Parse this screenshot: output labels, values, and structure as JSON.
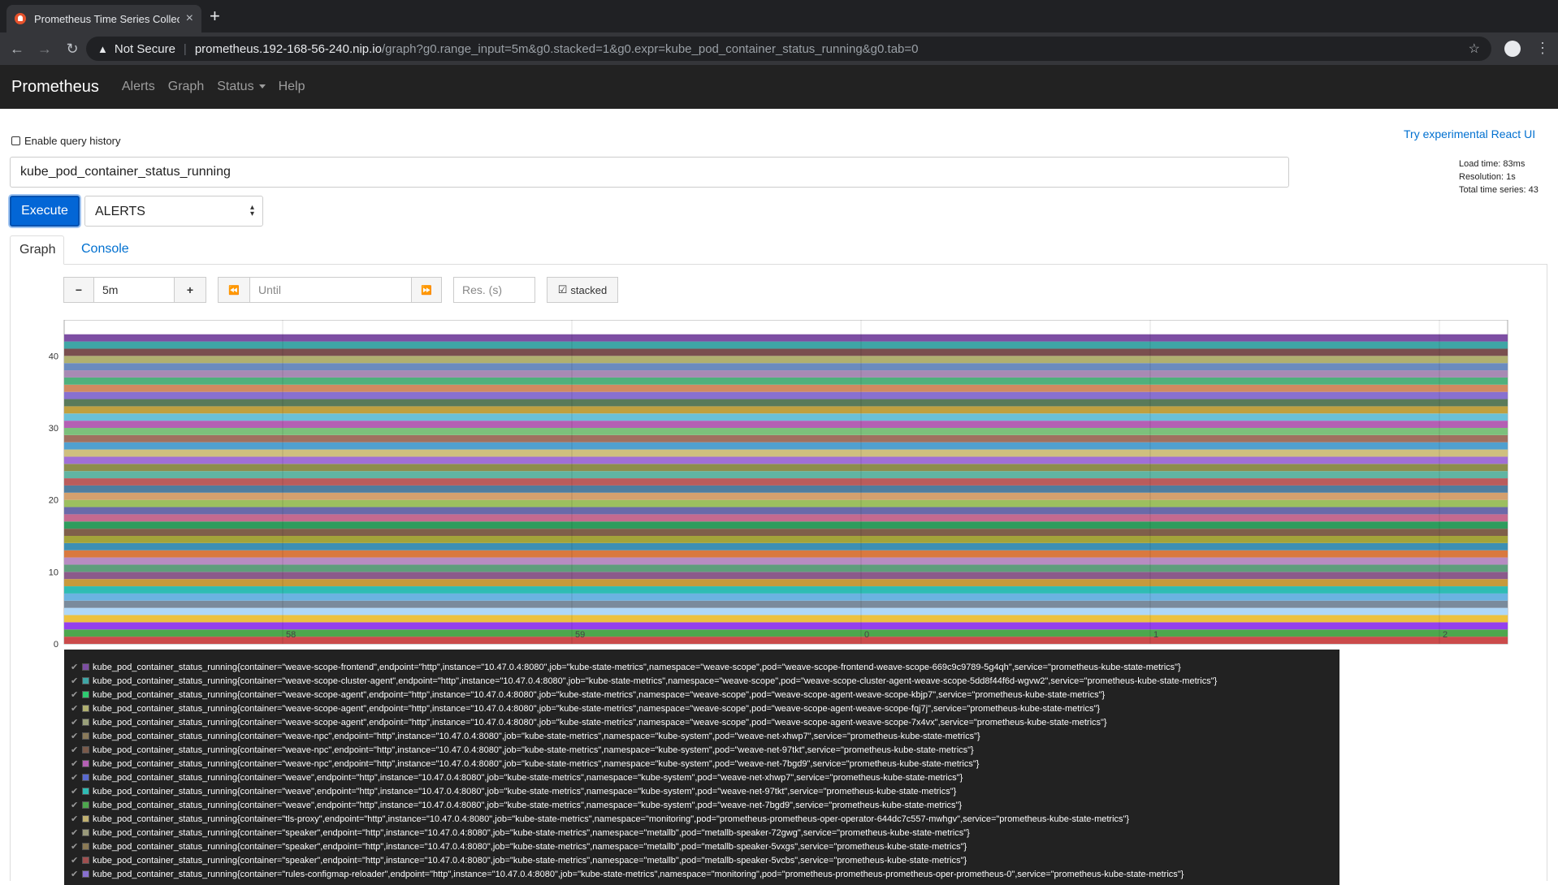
{
  "browser": {
    "tab_title": "Prometheus Time Series Collec",
    "new_tab": "+",
    "security": "Not Secure",
    "url_host": "prometheus.192-168-56-240.nip.io",
    "url_path": "/graph?g0.range_input=5m&g0.stacked=1&g0.expr=kube_pod_container_status_running&g0.tab=0"
  },
  "nav": {
    "brand": "Prometheus",
    "links": [
      "Alerts",
      "Graph",
      "Status",
      "Help"
    ]
  },
  "query": {
    "history_label": "Enable query history",
    "react_link": "Try experimental React UI",
    "stats": [
      "Load time: 83ms",
      "Resolution: 1s",
      "Total time series: 43"
    ],
    "expression": "kube_pod_container_status_running",
    "execute_label": "Execute",
    "insert_metric": "ALERTS"
  },
  "tabs": {
    "graph": "Graph",
    "console": "Console"
  },
  "controls": {
    "minus": "−",
    "range": "5m",
    "plus": "+",
    "back": "⏪",
    "until_placeholder": "Until",
    "forward": "⏩",
    "res_placeholder": "Res. (s)",
    "stacked": "stacked"
  },
  "chart_data": {
    "type": "area",
    "stacked": true,
    "ylim": [
      0,
      45
    ],
    "y_ticks": [
      "0",
      "10",
      "20",
      "30",
      "40"
    ],
    "x_ticks": [
      "58",
      "59",
      "0",
      "1",
      "2"
    ],
    "series_count": 43,
    "value_per_series": 1,
    "colors": [
      "#cb4b4b",
      "#4da74d",
      "#9440ed",
      "#edc240",
      "#afd8f8",
      "#7a8b9c",
      "#6bb3e1",
      "#2fbcb4",
      "#c79a3c",
      "#8b5a8b",
      "#5f9e7c",
      "#b88cc2",
      "#d9793f",
      "#3c8fb4",
      "#a3a33a",
      "#7f5f4a",
      "#2e9c5d",
      "#c56a8f",
      "#6a6aa9",
      "#9cbf5f",
      "#d4a06e",
      "#4f7d9f",
      "#ba5c5c",
      "#60b5a3",
      "#8d8d4c",
      "#a06fd6",
      "#cfbf7f",
      "#50a0d0",
      "#9f7060",
      "#7cc07c",
      "#b45fb4",
      "#6ac0d8",
      "#c0a040",
      "#5a7a5a",
      "#8870d0",
      "#d08a60",
      "#4fb07c",
      "#a88ab4",
      "#6a8bbf",
      "#b0b070",
      "#7a4f4f",
      "#3fa6a6",
      "#7d4ea3"
    ]
  },
  "legend": [
    {
      "text": "kube_pod_container_status_running{container=\"weave-scope-frontend\",endpoint=\"http\",instance=\"10.47.0.4:8080\",job=\"kube-state-metrics\",namespace=\"weave-scope\",pod=\"weave-scope-frontend-weave-scope-669c9c9789-5g4qh\",service=\"prometheus-kube-state-metrics\"}",
      "color": "#7d4ea3"
    },
    {
      "text": "kube_pod_container_status_running{container=\"weave-scope-cluster-agent\",endpoint=\"http\",instance=\"10.47.0.4:8080\",job=\"kube-state-metrics\",namespace=\"weave-scope\",pod=\"weave-scope-cluster-agent-weave-scope-5dd8f44f6d-wgvw2\",service=\"prometheus-kube-state-metrics\"}",
      "color": "#3fa6a6"
    },
    {
      "text": "kube_pod_container_status_running{container=\"weave-scope-agent\",endpoint=\"http\",instance=\"10.47.0.4:8080\",job=\"kube-state-metrics\",namespace=\"weave-scope\",pod=\"weave-scope-agent-weave-scope-kbjp7\",service=\"prometheus-kube-state-metrics\"}",
      "color": "#2ecc71"
    },
    {
      "text": "kube_pod_container_status_running{container=\"weave-scope-agent\",endpoint=\"http\",instance=\"10.47.0.4:8080\",job=\"kube-state-metrics\",namespace=\"weave-scope\",pod=\"weave-scope-agent-weave-scope-fqj7j\",service=\"prometheus-kube-state-metrics\"}",
      "color": "#b0b070"
    },
    {
      "text": "kube_pod_container_status_running{container=\"weave-scope-agent\",endpoint=\"http\",instance=\"10.47.0.4:8080\",job=\"kube-state-metrics\",namespace=\"weave-scope\",pod=\"weave-scope-agent-weave-scope-7x4vx\",service=\"prometheus-kube-state-metrics\"}",
      "color": "#9aa07a"
    },
    {
      "text": "kube_pod_container_status_running{container=\"weave-npc\",endpoint=\"http\",instance=\"10.47.0.4:8080\",job=\"kube-state-metrics\",namespace=\"kube-system\",pod=\"weave-net-xhwp7\",service=\"prometheus-kube-state-metrics\"}",
      "color": "#8a7a5a"
    },
    {
      "text": "kube_pod_container_status_running{container=\"weave-npc\",endpoint=\"http\",instance=\"10.47.0.4:8080\",job=\"kube-state-metrics\",namespace=\"kube-system\",pod=\"weave-net-97tkt\",service=\"prometheus-kube-state-metrics\"}",
      "color": "#7a5a4a"
    },
    {
      "text": "kube_pod_container_status_running{container=\"weave-npc\",endpoint=\"http\",instance=\"10.47.0.4:8080\",job=\"kube-state-metrics\",namespace=\"kube-system\",pod=\"weave-net-7bgd9\",service=\"prometheus-kube-state-metrics\"}",
      "color": "#b45fb4"
    },
    {
      "text": "kube_pod_container_status_running{container=\"weave\",endpoint=\"http\",instance=\"10.47.0.4:8080\",job=\"kube-state-metrics\",namespace=\"kube-system\",pod=\"weave-net-xhwp7\",service=\"prometheus-kube-state-metrics\"}",
      "color": "#5a6ad0"
    },
    {
      "text": "kube_pod_container_status_running{container=\"weave\",endpoint=\"http\",instance=\"10.47.0.4:8080\",job=\"kube-state-metrics\",namespace=\"kube-system\",pod=\"weave-net-97tkt\",service=\"prometheus-kube-state-metrics\"}",
      "color": "#2fbcb4"
    },
    {
      "text": "kube_pod_container_status_running{container=\"weave\",endpoint=\"http\",instance=\"10.47.0.4:8080\",job=\"kube-state-metrics\",namespace=\"kube-system\",pod=\"weave-net-7bgd9\",service=\"prometheus-kube-state-metrics\"}",
      "color": "#4da74d"
    },
    {
      "text": "kube_pod_container_status_running{container=\"tls-proxy\",endpoint=\"http\",instance=\"10.47.0.4:8080\",job=\"kube-state-metrics\",namespace=\"monitoring\",pod=\"prometheus-prometheus-oper-operator-644dc7c557-mwhgv\",service=\"prometheus-kube-state-metrics\"}",
      "color": "#c0b070"
    },
    {
      "text": "kube_pod_container_status_running{container=\"speaker\",endpoint=\"http\",instance=\"10.47.0.4:8080\",job=\"kube-state-metrics\",namespace=\"metallb\",pod=\"metallb-speaker-72gwg\",service=\"prometheus-kube-state-metrics\"}",
      "color": "#9a9a7a"
    },
    {
      "text": "kube_pod_container_status_running{container=\"speaker\",endpoint=\"http\",instance=\"10.47.0.4:8080\",job=\"kube-state-metrics\",namespace=\"metallb\",pod=\"metallb-speaker-5vxgs\",service=\"prometheus-kube-state-metrics\"}",
      "color": "#8b7a55"
    },
    {
      "text": "kube_pod_container_status_running{container=\"speaker\",endpoint=\"http\",instance=\"10.47.0.4:8080\",job=\"kube-state-metrics\",namespace=\"metallb\",pod=\"metallb-speaker-5vcbs\",service=\"prometheus-kube-state-metrics\"}",
      "color": "#a04f4f"
    },
    {
      "text": "kube_pod_container_status_running{container=\"rules-configmap-reloader\",endpoint=\"http\",instance=\"10.47.0.4:8080\",job=\"kube-state-metrics\",namespace=\"monitoring\",pod=\"prometheus-prometheus-prometheus-oper-prometheus-0\",service=\"prometheus-kube-state-metrics\"}",
      "color": "#8870d0"
    }
  ]
}
